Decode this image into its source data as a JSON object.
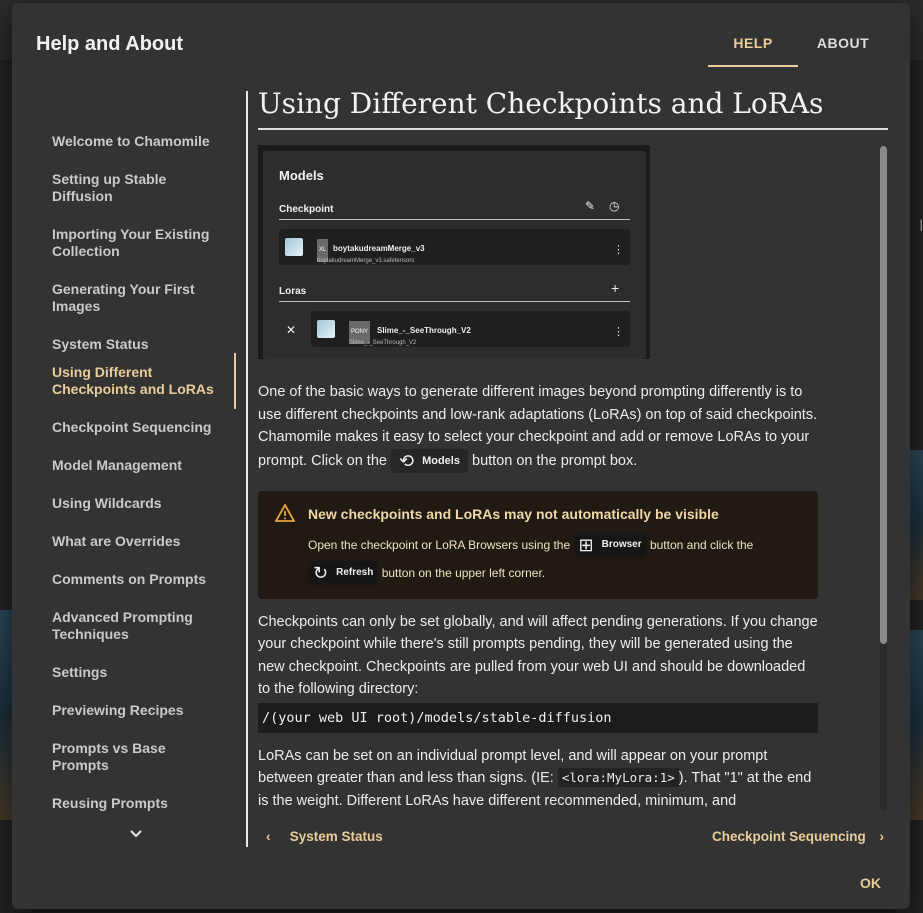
{
  "dialog": {
    "title": "Help and About",
    "tabs": [
      {
        "label": "HELP"
      },
      {
        "label": "ABOUT"
      }
    ],
    "ok_label": "OK"
  },
  "nav": {
    "items": [
      {
        "label": "Welcome to Chamomile"
      },
      {
        "label": "Setting up Stable Diffusion"
      },
      {
        "label": "Importing Your Existing Collection"
      },
      {
        "label": "Generating Your First Images"
      },
      {
        "label": "System Status"
      },
      {
        "label": "Using Different Checkpoints and LoRAs"
      },
      {
        "label": "Checkpoint Sequencing"
      },
      {
        "label": "Model Management"
      },
      {
        "label": "Using Wildcards"
      },
      {
        "label": "What are Overrides"
      },
      {
        "label": "Comments on Prompts"
      },
      {
        "label": "Advanced Prompting Techniques"
      },
      {
        "label": "Settings"
      },
      {
        "label": "Previewing Recipes"
      },
      {
        "label": "Prompts vs Base Prompts"
      },
      {
        "label": "Reusing Prompts"
      }
    ]
  },
  "article": {
    "title": "Using Different Checkpoints and LoRAs",
    "screenshot": {
      "models_heading": "Models",
      "checkpoint_heading": "Checkpoint",
      "checkpoint_tag": "XL",
      "checkpoint_name": "boytakudreamMerge_v3",
      "checkpoint_file": "boytakudreamMerge_v3.safetensors",
      "loras_heading": "Loras",
      "lora_tag": "PONY",
      "lora_name": "Slime_-_SeeThrough_V2",
      "lora_file": "Slime_-_SeeThrough_V2"
    },
    "para1_text": "One of the basic ways to generate different images beyond prompting differently is to use different checkpoints and low-rank adaptations (LoRAs) on top of said checkpoints. Chamomile makes it easy to select your checkpoint and add or remove LoRAs to your prompt. Click on the",
    "para1_button": "Models",
    "para1_after": "button on the prompt box.",
    "warning": {
      "title": "New checkpoints and LoRAs may not automatically be visible",
      "text1": "Open the checkpoint or LoRA Browsers using the",
      "browser_button": "Browser",
      "text2": "button and click the",
      "refresh_button": "Refresh",
      "text3": "button on the upper left corner."
    },
    "para2": "Checkpoints can only be set globally, and will affect pending generations. If you change your checkpoint while there's still prompts pending, they will be generated using the new checkpoint. Checkpoints are pulled from your web UI and should be downloaded to the following directory:",
    "code_path": "/(your web UI root)/models/stable-diffusion",
    "para3_before": "LoRAs can be set on an individual prompt level, and will appear on your prompt between greater than and less than signs. (IE:",
    "para3_code": "<lora:MyLora:1>",
    "para3_after": "). That \"1\" at the end is the weight. Different LoRAs have different recommended, minimum, and"
  },
  "pager": {
    "prev_label": "System Status",
    "next_label": "Checkpoint Sequencing"
  },
  "icons": {
    "warning": "warning-triangle-icon",
    "models": "models-icon",
    "browser": "grid-icon",
    "refresh": "refresh-icon"
  },
  "colors": {
    "accent": "#e8cc9a",
    "dialog_bg": "#333333",
    "warning_bg": "#201a12",
    "warning_icon": "#e3a43a"
  }
}
